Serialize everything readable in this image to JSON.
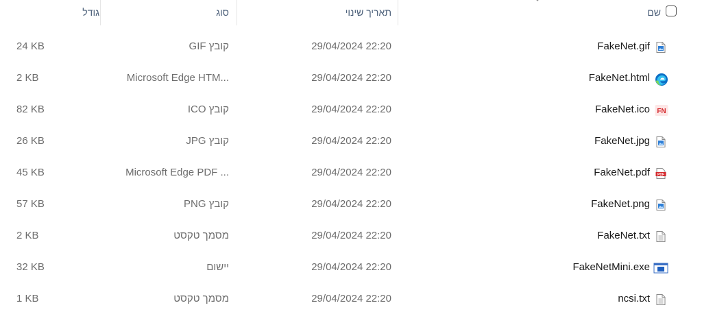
{
  "columns": {
    "name": "שם",
    "date": "תאריך שינוי",
    "type": "סוג",
    "size": "גודל"
  },
  "files": [
    {
      "name": "FakeNet.gif",
      "date": "29/04/2024 22:20",
      "type": "קובץ GIF",
      "size": "24 KB",
      "icon": "image-file-icon"
    },
    {
      "name": "FakeNet.html",
      "date": "29/04/2024 22:20",
      "type": "Microsoft Edge HTM...",
      "size": "2 KB",
      "icon": "edge-icon"
    },
    {
      "name": "FakeNet.ico",
      "date": "29/04/2024 22:20",
      "type": "קובץ ICO",
      "size": "82 KB",
      "icon": "fakenet-ico-icon"
    },
    {
      "name": "FakeNet.jpg",
      "date": "29/04/2024 22:20",
      "type": "קובץ JPG",
      "size": "26 KB",
      "icon": "image-file-icon"
    },
    {
      "name": "FakeNet.pdf",
      "date": "29/04/2024 22:20",
      "type": "Microsoft Edge PDF ...",
      "size": "45 KB",
      "icon": "pdf-icon"
    },
    {
      "name": "FakeNet.png",
      "date": "29/04/2024 22:20",
      "type": "קובץ PNG",
      "size": "57 KB",
      "icon": "image-file-icon"
    },
    {
      "name": "FakeNet.txt",
      "date": "29/04/2024 22:20",
      "type": "מסמך טקסט",
      "size": "2 KB",
      "icon": "text-file-icon"
    },
    {
      "name": "FakeNetMini.exe",
      "date": "29/04/2024 22:20",
      "type": "יישום",
      "size": "32 KB",
      "icon": "application-icon"
    },
    {
      "name": "ncsi.txt",
      "date": "29/04/2024 22:20",
      "type": "מסמך טקסט",
      "size": "1 KB",
      "icon": "text-file-icon"
    }
  ],
  "colors": {
    "header_text": "#4c607a",
    "secondary_text": "#6d6d6d",
    "edge_blue": "#0c6fc6",
    "pdf_red": "#d4282c"
  }
}
